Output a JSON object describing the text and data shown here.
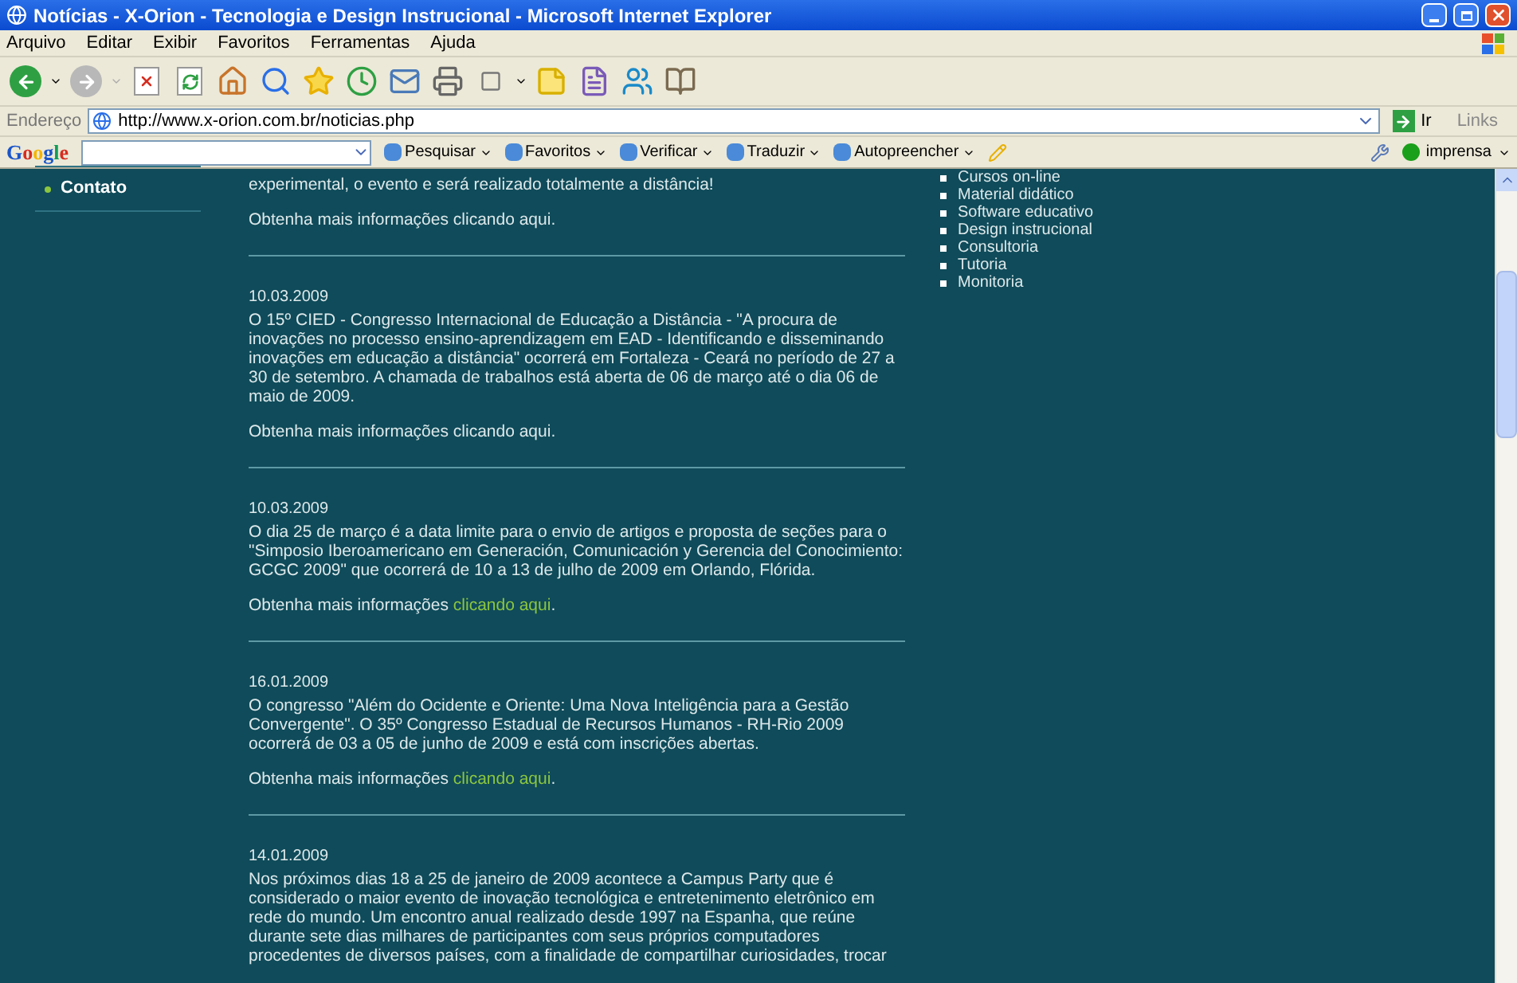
{
  "window": {
    "title": "Notícias - X-Orion - Tecnologia e Design Instrucional - Microsoft Internet Explorer"
  },
  "menu": [
    "Arquivo",
    "Editar",
    "Exibir",
    "Favoritos",
    "Ferramentas",
    "Ajuda"
  ],
  "address_bar": {
    "label": "Endereço",
    "url": "http://www.x-orion.com.br/noticias.php",
    "go": "Ir",
    "links": "Links"
  },
  "google_bar": {
    "logo": "Google",
    "buttons": [
      "Pesquisar",
      "Favoritos",
      "Verificar",
      "Traduzir",
      "Autopreencher"
    ],
    "account": "imprensa"
  },
  "sidebar": {
    "items": [
      {
        "label": "Contato"
      }
    ]
  },
  "news": [
    {
      "body": "experimental, o evento e será realizado totalmente a distância!",
      "more": "Obtenha mais informações",
      "link": "clicando aqui",
      "link_highlighted": false,
      "end": "."
    },
    {
      "date": "10.03.2009",
      "body": "O 15º CIED - Congresso Internacional de Educação a Distância - \"A procura de inovações no processo ensino-aprendizagem em EAD - Identificando e disseminando inovações em educação a distância\" ocorrerá em Fortaleza - Ceará no período de 27 a 30 de setembro. A chamada de trabalhos está aberta de 06 de março até o dia 06 de maio de 2009.",
      "more": "Obtenha mais informações",
      "link": "clicando aqui",
      "link_highlighted": false,
      "end": "."
    },
    {
      "date": "10.03.2009",
      "body": "O dia 25 de março é a data limite para o envio de artigos e proposta de seções para o \"Simposio Iberoamericano em Generación, Comunicación y Gerencia del Conocimiento: GCGC 2009\" que ocorrerá de 10 a 13 de julho de 2009 em Orlando, Flórida.",
      "more": "Obtenha mais informações",
      "link": "clicando aqui",
      "link_highlighted": true,
      "end": "."
    },
    {
      "date": "16.01.2009",
      "body": "O congresso \"Além do Ocidente e Oriente: Uma Nova Inteligência para a Gestão Convergente\". O 35º Congresso Estadual de Recursos Humanos - RH-Rio 2009 ocorrerá de 03 a 05 de junho de 2009 e está com inscrições abertas.",
      "more": "Obtenha mais informações",
      "link": "clicando aqui",
      "link_highlighted": true,
      "end": "."
    },
    {
      "date": "14.01.2009",
      "body": "Nos próximos dias 18 a 25 de janeiro de 2009 acontece a Campus Party que é considerado o maior evento de inovação tecnológica e entretenimento eletrônico em rede do mundo. Um encontro anual realizado desde 1997 na Espanha, que reúne durante sete dias milhares de participantes com seus próprios computadores procedentes de diversos países, com a finalidade de compartilhar curiosidades, trocar"
    }
  ],
  "services": [
    "Cursos on-line",
    "Material didático",
    "Software educativo",
    "Design instrucional",
    "Consultoria",
    "Tutoria",
    "Monitoria"
  ]
}
